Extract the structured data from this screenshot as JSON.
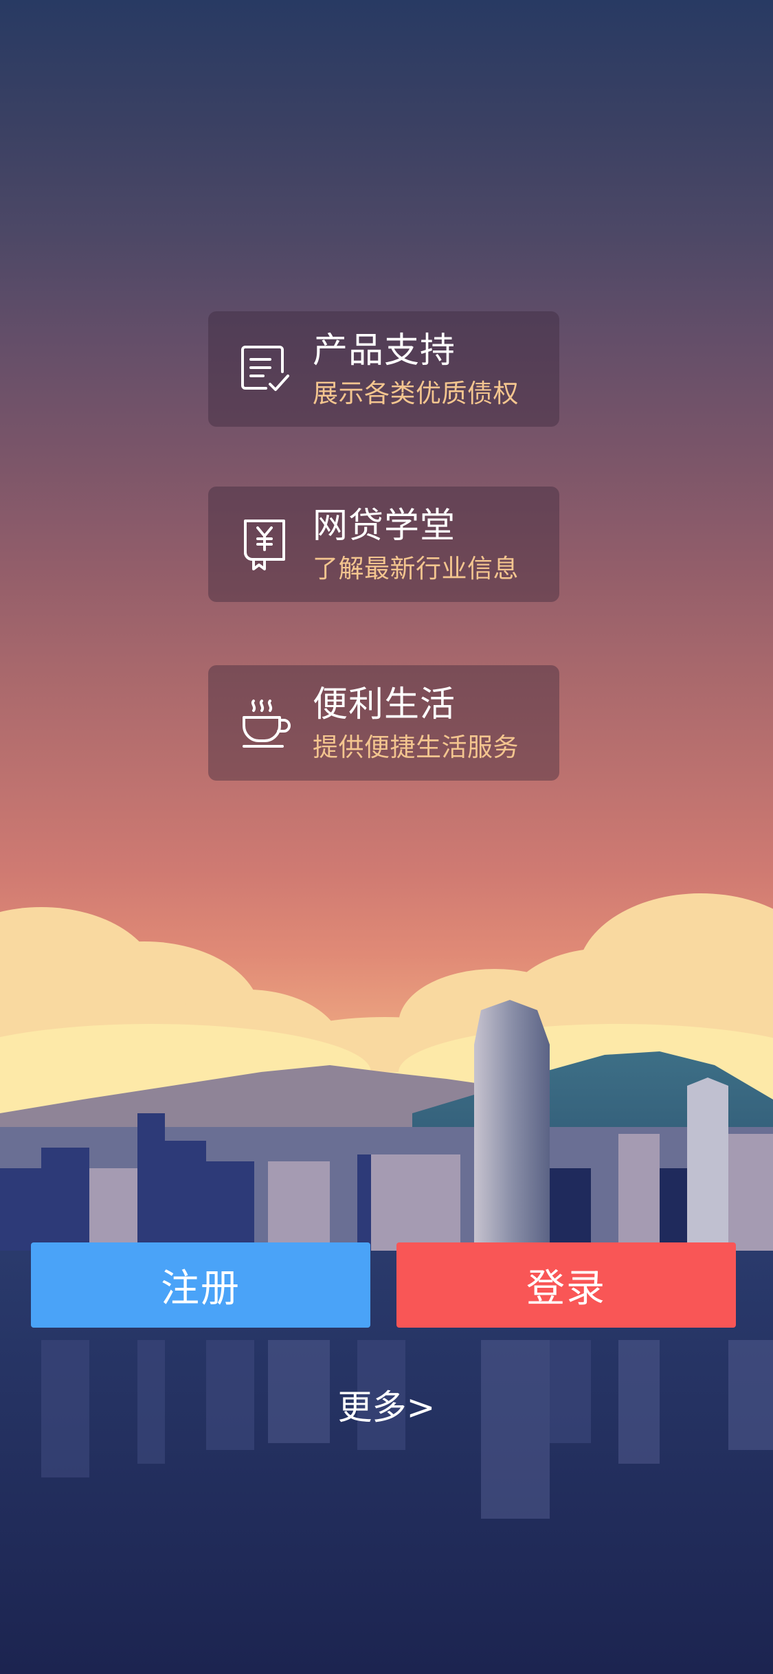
{
  "menu": [
    {
      "icon": "document-check-icon",
      "title": "产品支持",
      "subtitle": "展示各类优质债权"
    },
    {
      "icon": "yuan-book-icon",
      "title": "网贷学堂",
      "subtitle": "了解最新行业信息"
    },
    {
      "icon": "coffee-cup-icon",
      "title": "便利生活",
      "subtitle": "提供便捷生活服务"
    }
  ],
  "buttons": {
    "register_label": "注册",
    "login_label": "登录"
  },
  "more_label": "更多>",
  "colors": {
    "register": "#4aa3f8",
    "login": "#f95656",
    "subtitle": "#f3c58f"
  }
}
